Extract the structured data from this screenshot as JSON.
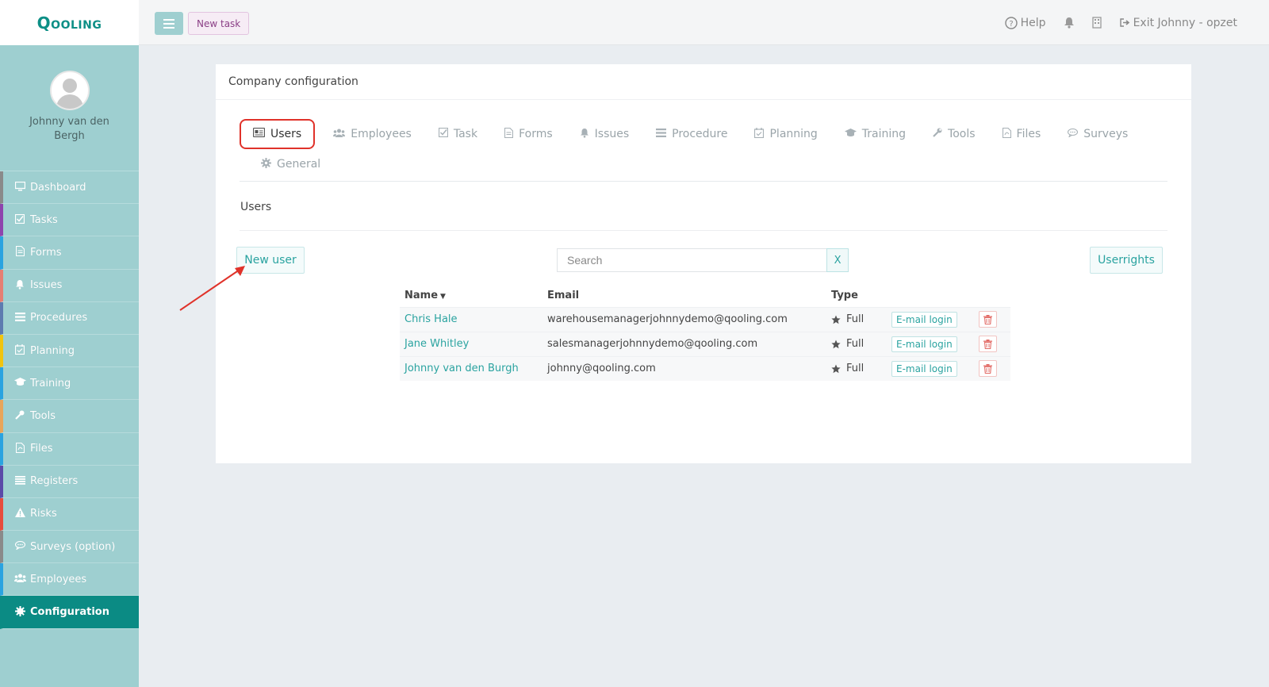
{
  "app": {
    "logo": "Qooling"
  },
  "header": {
    "new_task": "New task",
    "help": "Help",
    "exit": "Exit Johnny - opzet"
  },
  "sidebar": {
    "user_name": "Johnny van den Bergh",
    "items": [
      {
        "label": "Dashboard",
        "icon": "monitor-icon",
        "color": "#8a8a8a"
      },
      {
        "label": "Tasks",
        "icon": "checkbox-icon",
        "color": "#8e44ad"
      },
      {
        "label": "Forms",
        "icon": "document-icon",
        "color": "#2aa3e0"
      },
      {
        "label": "Issues",
        "icon": "bell-icon",
        "color": "#e67e73"
      },
      {
        "label": "Procedures",
        "icon": "list-icon",
        "color": "#5d7bb0"
      },
      {
        "label": "Planning",
        "icon": "calendar-icon",
        "color": "#f1c40f"
      },
      {
        "label": "Training",
        "icon": "graduation-cap-icon",
        "color": "#2aa3e0"
      },
      {
        "label": "Tools",
        "icon": "wrench-icon",
        "color": "#e8a55a"
      },
      {
        "label": "Files",
        "icon": "file-icon",
        "color": "#2aa3e0"
      },
      {
        "label": "Registers",
        "icon": "registers-icon",
        "color": "#5b4aa8"
      },
      {
        "label": "Risks",
        "icon": "warning-icon",
        "color": "#e74c3c"
      },
      {
        "label": "Surveys (option)",
        "icon": "chat-icon",
        "color": "#8a8a8a"
      },
      {
        "label": "Employees",
        "icon": "users-icon",
        "color": "#2aa3e0"
      },
      {
        "label": "Configuration",
        "icon": "gear-icon",
        "color": "#0b8b84",
        "active": true
      }
    ]
  },
  "page": {
    "title": "Company configuration",
    "tabs": [
      {
        "label": "Users",
        "icon": "id-card-icon",
        "active": true
      },
      {
        "label": "Employees",
        "icon": "users-icon"
      },
      {
        "label": "Task",
        "icon": "checkbox-icon"
      },
      {
        "label": "Forms",
        "icon": "document-icon"
      },
      {
        "label": "Issues",
        "icon": "bell-icon"
      },
      {
        "label": "Procedure",
        "icon": "list-icon"
      },
      {
        "label": "Planning",
        "icon": "calendar-icon"
      },
      {
        "label": "Training",
        "icon": "graduation-cap-icon"
      },
      {
        "label": "Tools",
        "icon": "wrench-icon"
      },
      {
        "label": "Files",
        "icon": "file-icon"
      },
      {
        "label": "Surveys",
        "icon": "chat-icon"
      },
      {
        "label": "General",
        "icon": "gear-icon"
      }
    ],
    "section_title": "Users",
    "new_user": "New user",
    "search": {
      "placeholder": "Search",
      "clear": "X"
    },
    "userrights": "Userrights",
    "table": {
      "columns": [
        "Name",
        "Email",
        "Type"
      ],
      "rows": [
        {
          "name": "Chris Hale",
          "email": "warehousemanagerjohnnydemo@qooling.com",
          "type": "Full",
          "login": "E-mail login"
        },
        {
          "name": "Jane Whitley",
          "email": "salesmanagerjohnnydemo@qooling.com",
          "type": "Full",
          "login": "E-mail login"
        },
        {
          "name": "Johnny van den Burgh",
          "email": "johnny@qooling.com",
          "type": "Full",
          "login": "E-mail login"
        }
      ]
    }
  }
}
